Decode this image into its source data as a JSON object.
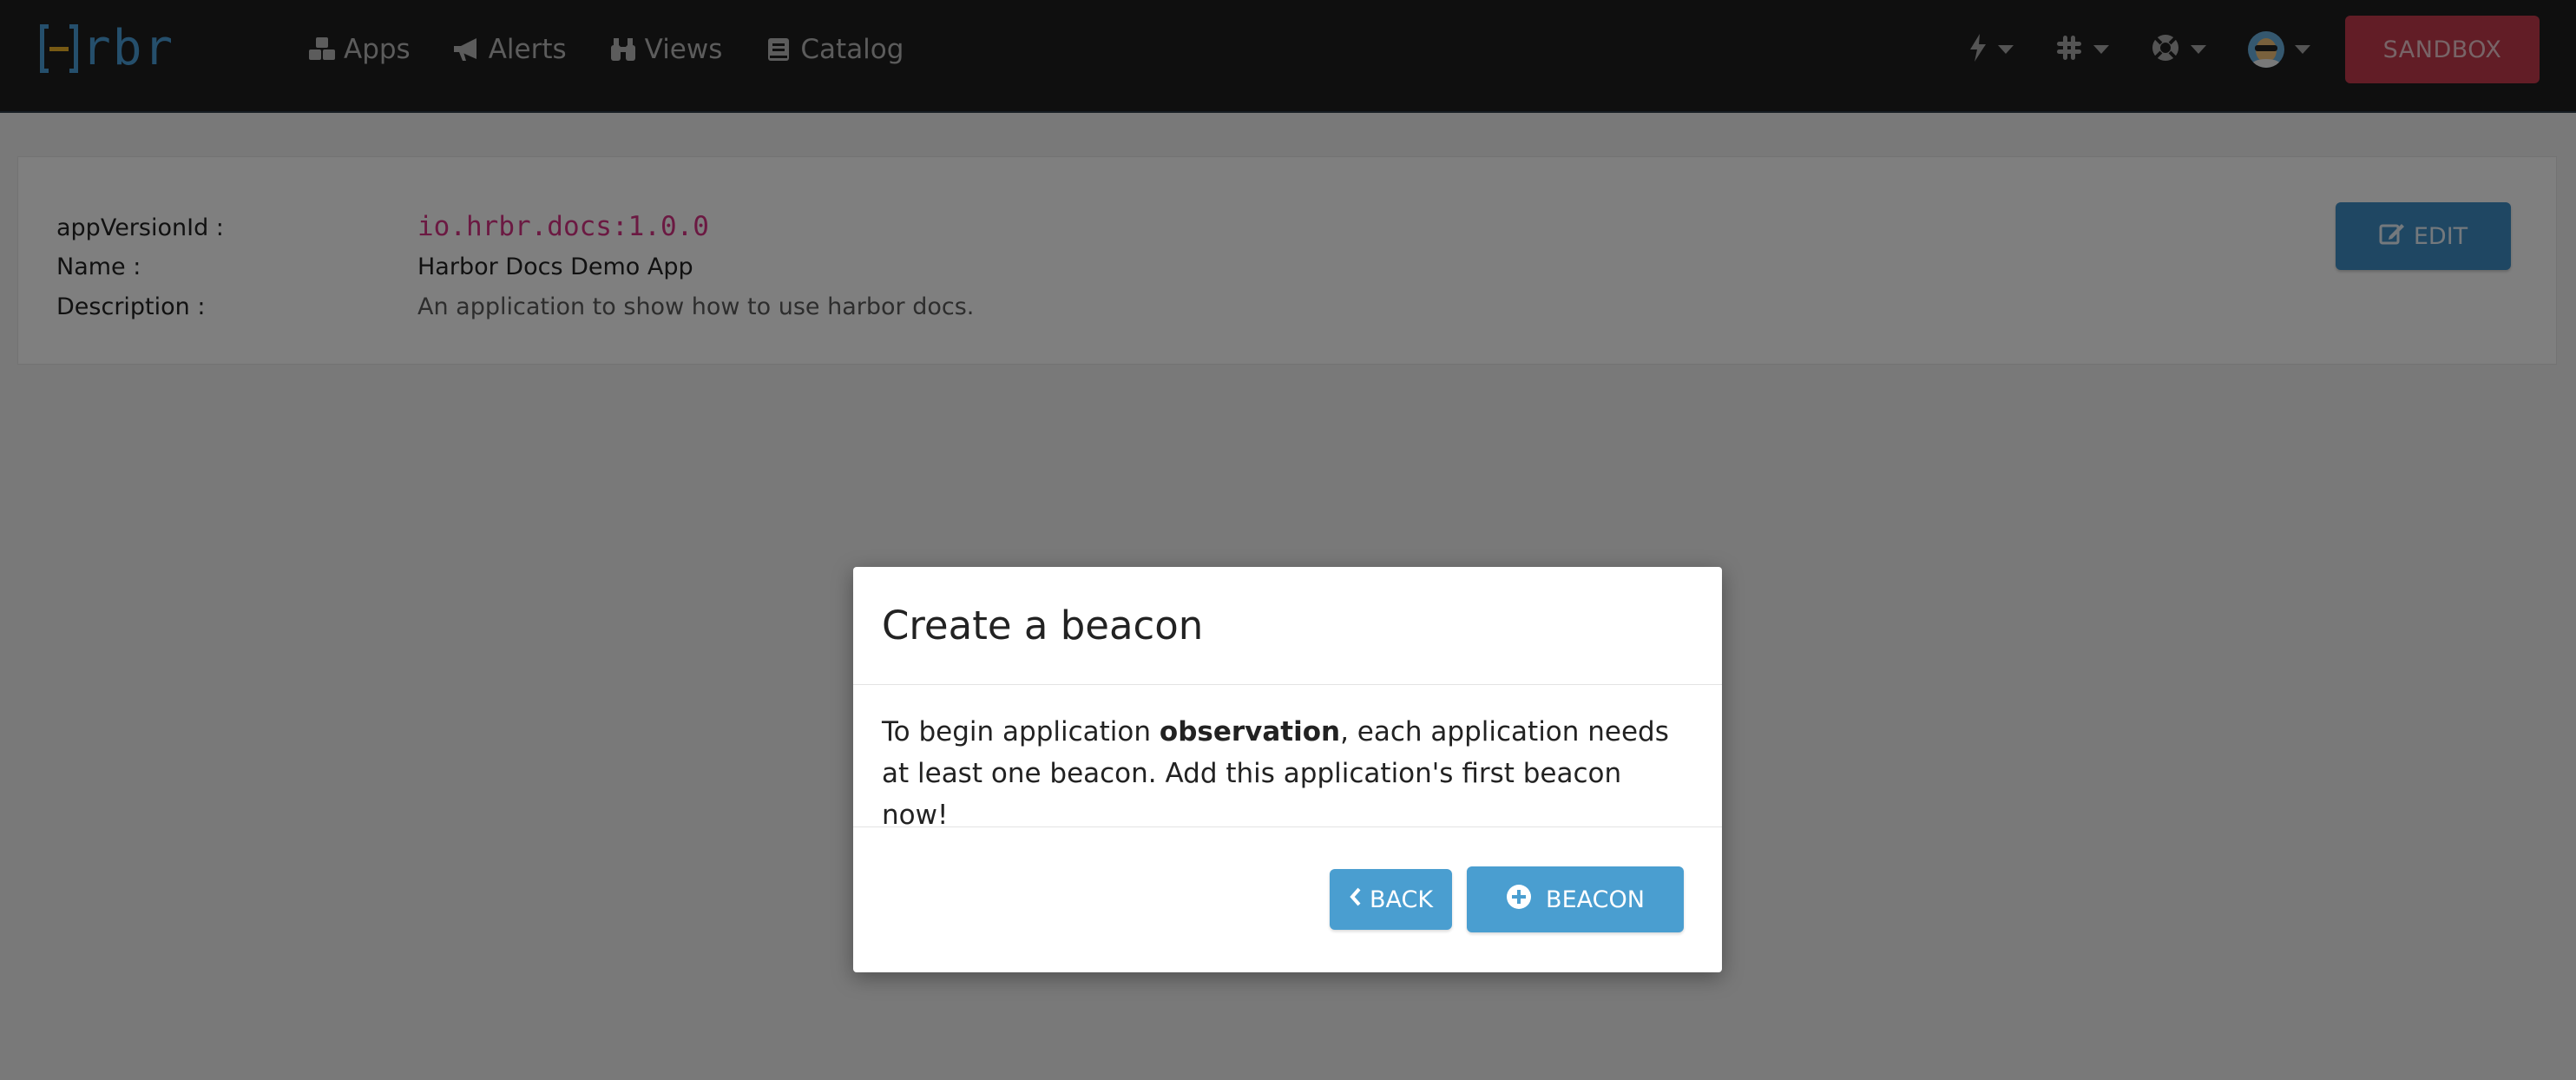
{
  "navbar": {
    "logo_text": "rbr",
    "links": [
      {
        "label": "Apps",
        "icon": "cubes-icon"
      },
      {
        "label": "Alerts",
        "icon": "bullhorn-icon"
      },
      {
        "label": "Views",
        "icon": "binoculars-icon"
      },
      {
        "label": "Catalog",
        "icon": "book-icon"
      }
    ],
    "right_menus": [
      "bolt-icon",
      "slack-icon",
      "life-ring-icon",
      "user-avatar"
    ],
    "sandbox_label": "SANDBOX",
    "sandbox_color": "#c43b4c"
  },
  "app": {
    "fields": [
      {
        "label": "appVersionId :",
        "value": "io.hrbr.docs:1.0.0"
      },
      {
        "label": "Name :",
        "value": "Harbor Docs Demo App"
      },
      {
        "label": "Description :",
        "value": "An application to show how to use harbor docs."
      }
    ],
    "edit_label": "EDIT"
  },
  "modal": {
    "title": "Create a beacon",
    "body_before": "To begin application ",
    "body_bold": "observation",
    "body_after": ", each application needs at least one beacon. Add this application's first beacon now!",
    "back_label": "BACK",
    "beacon_label": "BEACON",
    "button_color": "#4a9ed0"
  }
}
